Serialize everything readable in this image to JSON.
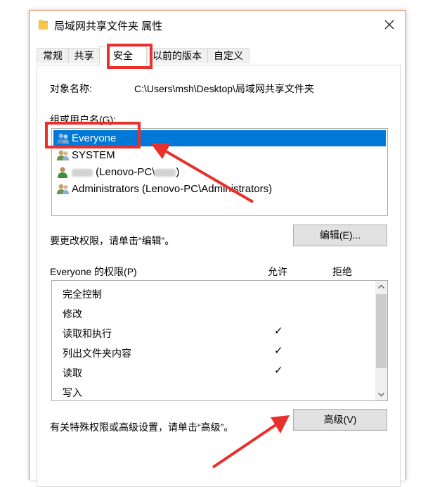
{
  "window": {
    "title": "局域网共享文件夹 属性"
  },
  "tabs": [
    {
      "label": "常规"
    },
    {
      "label": "共享"
    },
    {
      "label": "安全"
    },
    {
      "label": "以前的版本"
    },
    {
      "label": "自定义"
    }
  ],
  "active_tab": "安全",
  "object_name": {
    "label": "对象名称:",
    "value": "C:\\Users\\msh\\Desktop\\局域网共享文件夹"
  },
  "groups": {
    "label": "组或用户名(G):",
    "items": [
      {
        "name": "Everyone",
        "selected": true
      },
      {
        "name": "SYSTEM"
      },
      {
        "name": "(Lenovo-PC\\",
        "suffix": ")"
      },
      {
        "name": "Administrators (Lenovo-PC\\Administrators)"
      }
    ]
  },
  "edit_hint": "要更改权限，请单击“编辑”。",
  "edit_button": "编辑(E)...",
  "permissions": {
    "label": "Everyone 的权限(P)",
    "allow_header": "允许",
    "deny_header": "拒绝",
    "check_glyph": "✓",
    "rows": [
      {
        "name": "完全控制",
        "allow": false,
        "deny": false
      },
      {
        "name": "修改",
        "allow": false,
        "deny": false
      },
      {
        "name": "读取和执行",
        "allow": true,
        "deny": false
      },
      {
        "name": "列出文件夹内容",
        "allow": true,
        "deny": false
      },
      {
        "name": "读取",
        "allow": true,
        "deny": false
      },
      {
        "name": "写入",
        "allow": false,
        "deny": false
      }
    ]
  },
  "advanced_hint": "有关特殊权限或高级设置，请单击“高级”。",
  "advanced_button": "高级(V)",
  "colors": {
    "selection": "#0078d7",
    "highlight": "#e8302c",
    "window_border": "#e07b50"
  }
}
